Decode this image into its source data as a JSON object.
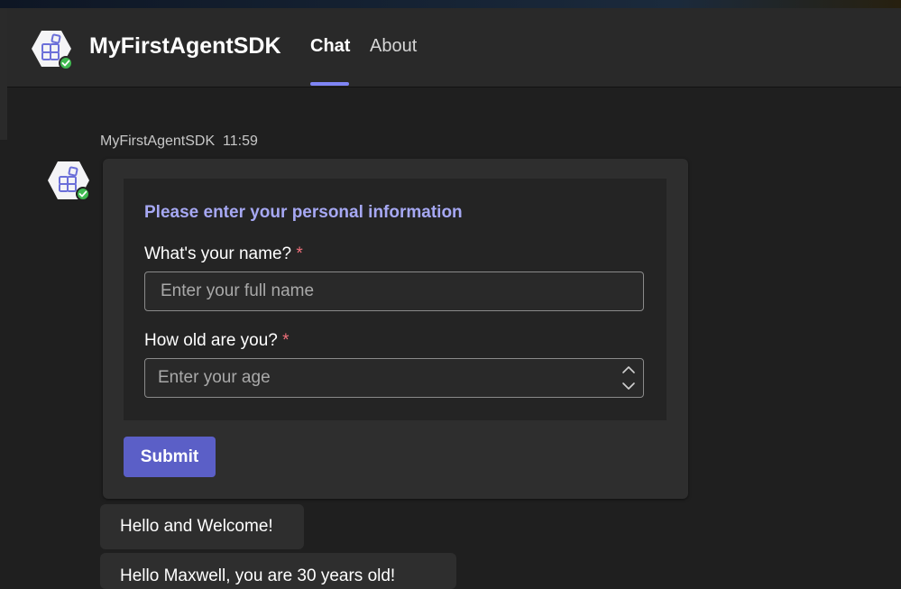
{
  "header": {
    "app_title": "MyFirstAgentSDK",
    "app_icon": "agent-app-icon",
    "status": "online",
    "tabs": [
      {
        "label": "Chat",
        "active": true
      },
      {
        "label": "About",
        "active": false
      }
    ]
  },
  "message": {
    "sender": "MyFirstAgentSDK",
    "time": "11:59",
    "card": {
      "title": "Please enter your personal information",
      "name_label": "What's your name?",
      "name_placeholder": "Enter your full name",
      "age_label": "How old are you?",
      "age_placeholder": "Enter your age",
      "required_marker": "*",
      "submit_label": "Submit"
    }
  },
  "replies": [
    {
      "text": "Hello and Welcome!"
    },
    {
      "text": "Hello Maxwell, you are 30 years old!"
    }
  ],
  "colors": {
    "accent": "#5b5fc7",
    "tab_underline": "#7f85f5",
    "card_title": "#a6a8f3",
    "required": "#f1707b",
    "presence": "#3fb950"
  }
}
